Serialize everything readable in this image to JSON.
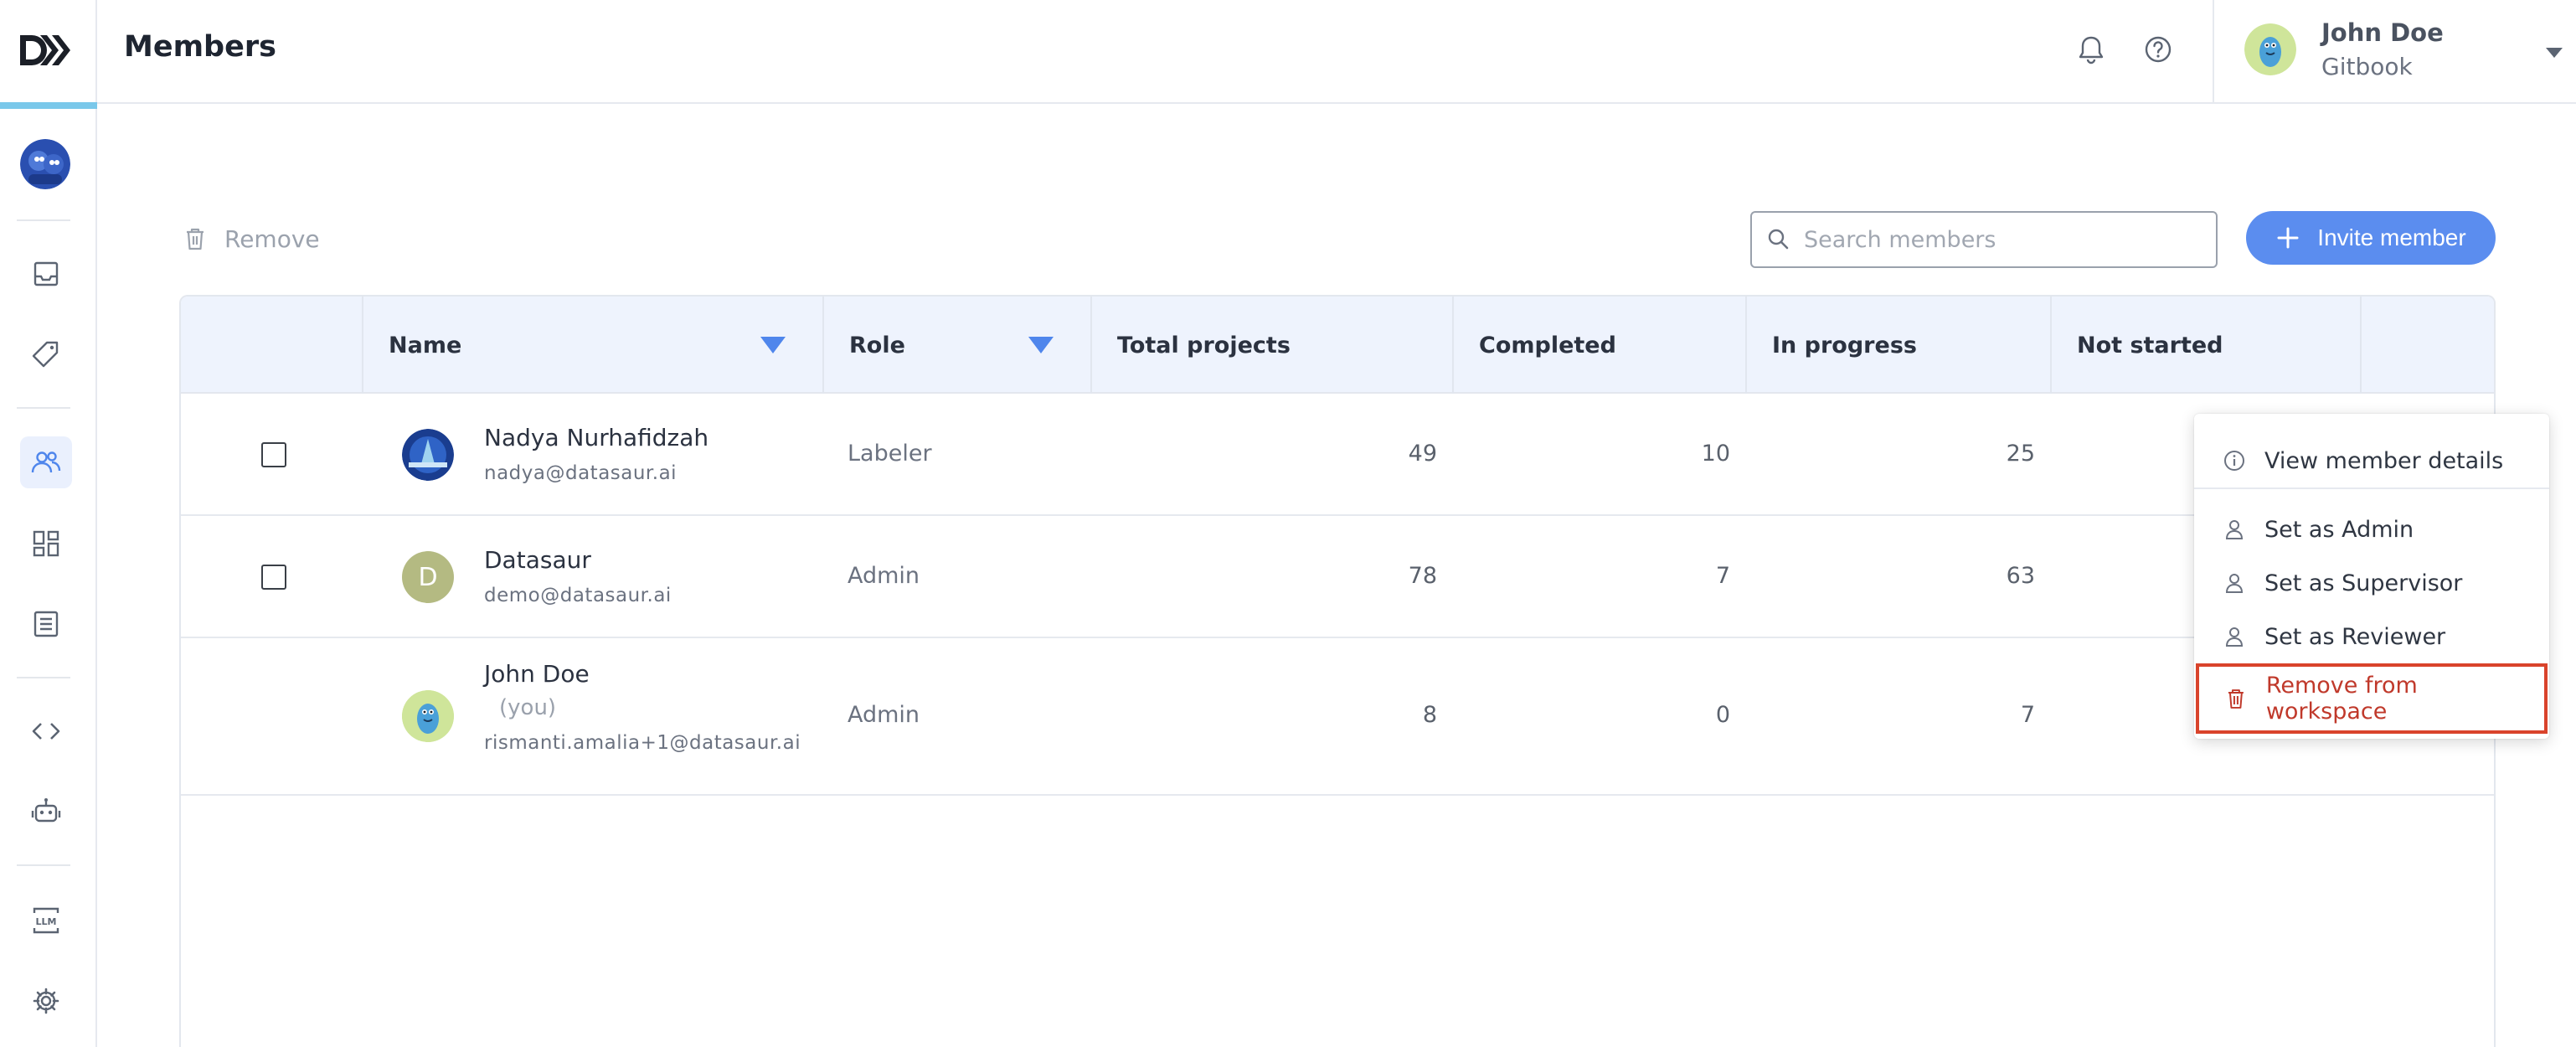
{
  "header": {
    "title": "Members",
    "user": {
      "name": "John Doe",
      "org": "Gitbook"
    }
  },
  "toolbar": {
    "remove_label": "Remove",
    "search_placeholder": "Search members",
    "invite_label": "Invite member"
  },
  "table": {
    "columns": [
      "Name",
      "Role",
      "Total projects",
      "Completed",
      "In progress",
      "Not started"
    ],
    "rows": [
      {
        "name": "Nadya Nurhafidzah",
        "you": "",
        "email": "nadya@datasaur.ai",
        "role": "Labeler",
        "total": "49",
        "completed": "10",
        "in_progress": "25",
        "avatar": "photo",
        "checkbox": true
      },
      {
        "name": "Datasaur",
        "you": "",
        "email": "demo@datasaur.ai",
        "role": "Admin",
        "total": "78",
        "completed": "7",
        "in_progress": "63",
        "avatar": "D",
        "checkbox": true
      },
      {
        "name": "John Doe",
        "you": "(you)",
        "email": "rismanti.amalia+1@datasaur.ai",
        "role": "Admin",
        "total": "8",
        "completed": "0",
        "in_progress": "7",
        "avatar": "dino",
        "checkbox": false
      }
    ]
  },
  "menu": {
    "items": [
      "View member details",
      "Set as Admin",
      "Set as Supervisor",
      "Set as Reviewer",
      "Remove from workspace"
    ]
  },
  "sidebar": {
    "icons": [
      "inbox-icon",
      "tag-icon",
      "members-icon",
      "grid-icon",
      "document-icon",
      "code-icon",
      "robot-icon",
      "llm-icon",
      "gear-icon"
    ]
  },
  "colors": {
    "accent": "#5b8def",
    "danger": "#d9432b",
    "header_bg": "#eef3fd"
  }
}
